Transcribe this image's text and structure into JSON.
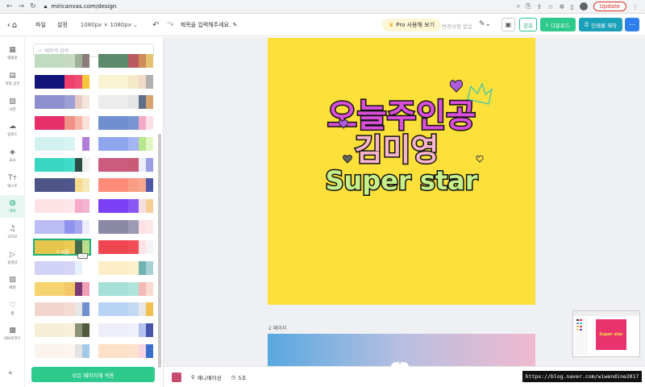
{
  "browser": {
    "url": "miricanvas.com/design",
    "update_label": "Update"
  },
  "topbar": {
    "file": "파일",
    "settings": "설정",
    "size": "1080px × 1080px",
    "title_placeholder": "제목을 입력해주세요.",
    "pro_label": "Pro 사용해 보기",
    "history": "변경사항 없음",
    "share": "공유",
    "download": "다운로드",
    "print": "인쇄물 제작"
  },
  "rail": {
    "items": [
      {
        "label": "템플릿",
        "icon": "template-icon"
      },
      {
        "label": "작업 공간",
        "icon": "workspace-icon"
      },
      {
        "label": "사진",
        "icon": "photo-icon"
      },
      {
        "label": "업로드",
        "icon": "upload-icon"
      },
      {
        "label": "요소",
        "icon": "elements-icon"
      },
      {
        "label": "텍스트",
        "icon": "text-icon"
      },
      {
        "label": "테마",
        "icon": "theme-icon"
      },
      {
        "label": "오디오",
        "icon": "audio-icon"
      },
      {
        "label": "동영상",
        "icon": "video-icon"
      },
      {
        "label": "배경",
        "icon": "background-icon"
      },
      {
        "label": "찜",
        "icon": "heart-icon"
      },
      {
        "label": "QR/바코드",
        "icon": "qr-icon"
      }
    ]
  },
  "panel": {
    "search_placeholder": "테마색 검색",
    "shuffle_label": "셔플",
    "apply_label": "모든 페이지에 적용",
    "palettes": [
      [
        "#bfdcc0",
        "#c8d9c2",
        "#9cb39a",
        "#8d7d79"
      ],
      [
        "#5c8a6d",
        "#b95a5e",
        "#cf8a5c",
        "#e3c26f"
      ],
      [
        "#14157a",
        "#ef3f6c",
        "#ef4d72",
        "#f5c53a"
      ],
      [
        "#f7f3d3",
        "#f3e9c9",
        "#f0d9c6",
        "#b0b0b0"
      ],
      [
        "#8f8fcf",
        "#9b9fd4",
        "#e6cbc5",
        "#f4e4d9"
      ],
      [
        "#ececec",
        "#e5e5e5",
        "#5f6f8a",
        "#d8a271"
      ],
      [
        "#e6306a",
        "#f29185",
        "#f5b5a8",
        "#fbe0d8"
      ],
      [
        "#6f8fcf",
        "#7a96d2",
        "#f4a9c7",
        "#fce0e6"
      ],
      [
        "#d3f1f1",
        "#d9f4f5",
        "#ffffff",
        "#b07ed9"
      ],
      [
        "#8fa6ef",
        "#a5b4f2",
        "#b7e68c",
        "#e2f6c3"
      ],
      [
        "#38d6c1",
        "#41dcc7",
        "#2e4c46",
        "#f1f1f1"
      ],
      [
        "#cc5c7d",
        "#c85b78",
        "#ececf8",
        "#9a9ee3"
      ],
      [
        "#4c5488",
        "#4f568c",
        "#f7da8c",
        "#f5e7b7"
      ],
      [
        "#ff8a7a",
        "#f99d84",
        "#f7a58d",
        "#4e58a6"
      ],
      [
        "#fde3e6",
        "#fde6ea",
        "#f6a9c9",
        "#f6b3d1"
      ],
      [
        "#7b3ff5",
        "#8a56f5",
        "#f4dee0",
        "#f5cf95"
      ],
      [
        "#bcbdf6",
        "#8e93f0",
        "#a6a6ee",
        "#ececfb"
      ],
      [
        "#8b8aa6",
        "#9c9bb6",
        "#fde1e5",
        "#fde6e8"
      ],
      [
        "#e6c64a",
        "#eccc54",
        "#446b4c",
        "#bbdd8c"
      ],
      [
        "#ef4550",
        "#f04d56",
        "#fde1e3",
        "#f3f3f3"
      ],
      [
        "#d2d1f6",
        "#d6d5f8",
        "#e6f2fb",
        "#ffffff"
      ],
      [
        "#fdeec7",
        "#fdf0cc",
        "#71b3b3",
        "#a7d1d2"
      ],
      [
        "#f5d36f",
        "#f4c869",
        "#7b3a74",
        "#f0a0b5"
      ],
      [
        "#a7e0d6",
        "#b0e5dc",
        "#f3b9b5",
        "#fad9d0"
      ],
      [
        "#f2d6cd",
        "#f5dbd2",
        "#e6e6e6",
        "#6f8fcf"
      ],
      [
        "#b8d3f3",
        "#c2d9f4",
        "#e7e7e7",
        "#f2c04f"
      ],
      [
        "#f6eed6",
        "#f8f0d9",
        "#8c9374",
        "#4f5a3f"
      ],
      [
        "#eeeefb",
        "#f1f1fc",
        "#b5c1ef",
        "#4754a8"
      ],
      [
        "#fbf3ee",
        "#fcf4ef",
        "#e3e3e3",
        "#a4c9e6"
      ],
      [
        "#fde0c8",
        "#fde3cb",
        "#f7d2e0",
        "#3a6fd0"
      ]
    ]
  },
  "canvas": {
    "page1_bg": "#fde03a",
    "page2_label": "2 페이지",
    "artwork_line1": "오늘주인공",
    "artwork_line2": "김미영",
    "artwork_line3": "Super star"
  },
  "bottombar": {
    "chip_color": "#c64b6c",
    "animation": "애니메이션",
    "duration": "5초"
  },
  "watermark": "https://blog.naver.com/wiwendine2017"
}
